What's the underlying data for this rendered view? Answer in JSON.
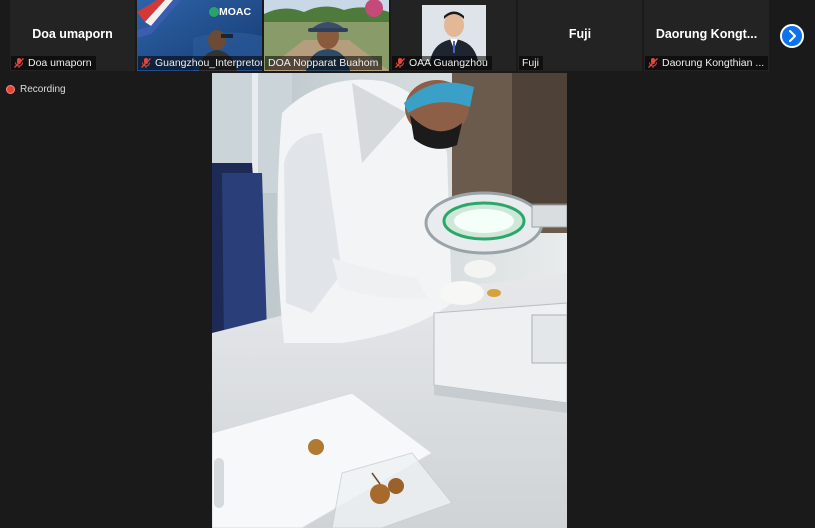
{
  "participants": [
    {
      "big_name": "Doa umaporn",
      "label": "Doa umaporn",
      "muted": true,
      "has_video": false
    },
    {
      "big_name": "",
      "label": "Guangzhou_Interpretor",
      "muted": true,
      "has_video": true,
      "logo_text": "MOAC"
    },
    {
      "big_name": "",
      "label": "DOA Nopparat Buahom",
      "muted": false,
      "has_video": true
    },
    {
      "big_name": "",
      "label": "OAA Guangzhou",
      "muted": true,
      "has_video": true
    },
    {
      "big_name": "Fuji",
      "label": "Fuji",
      "muted": false,
      "has_video": false
    },
    {
      "big_name": "Daorung  Kongt...",
      "label": "Daorung Kongthian ...",
      "muted": true,
      "has_video": false
    }
  ],
  "recording": {
    "label": "Recording"
  },
  "colors": {
    "background": "#1a1a1a",
    "tile": "#232323",
    "accent": "#0e72ed",
    "muted_icon": "#e0473a"
  },
  "icons": {
    "next": "chevron-right-icon",
    "mute": "mic-off-icon",
    "recording": "record-dot-icon"
  }
}
